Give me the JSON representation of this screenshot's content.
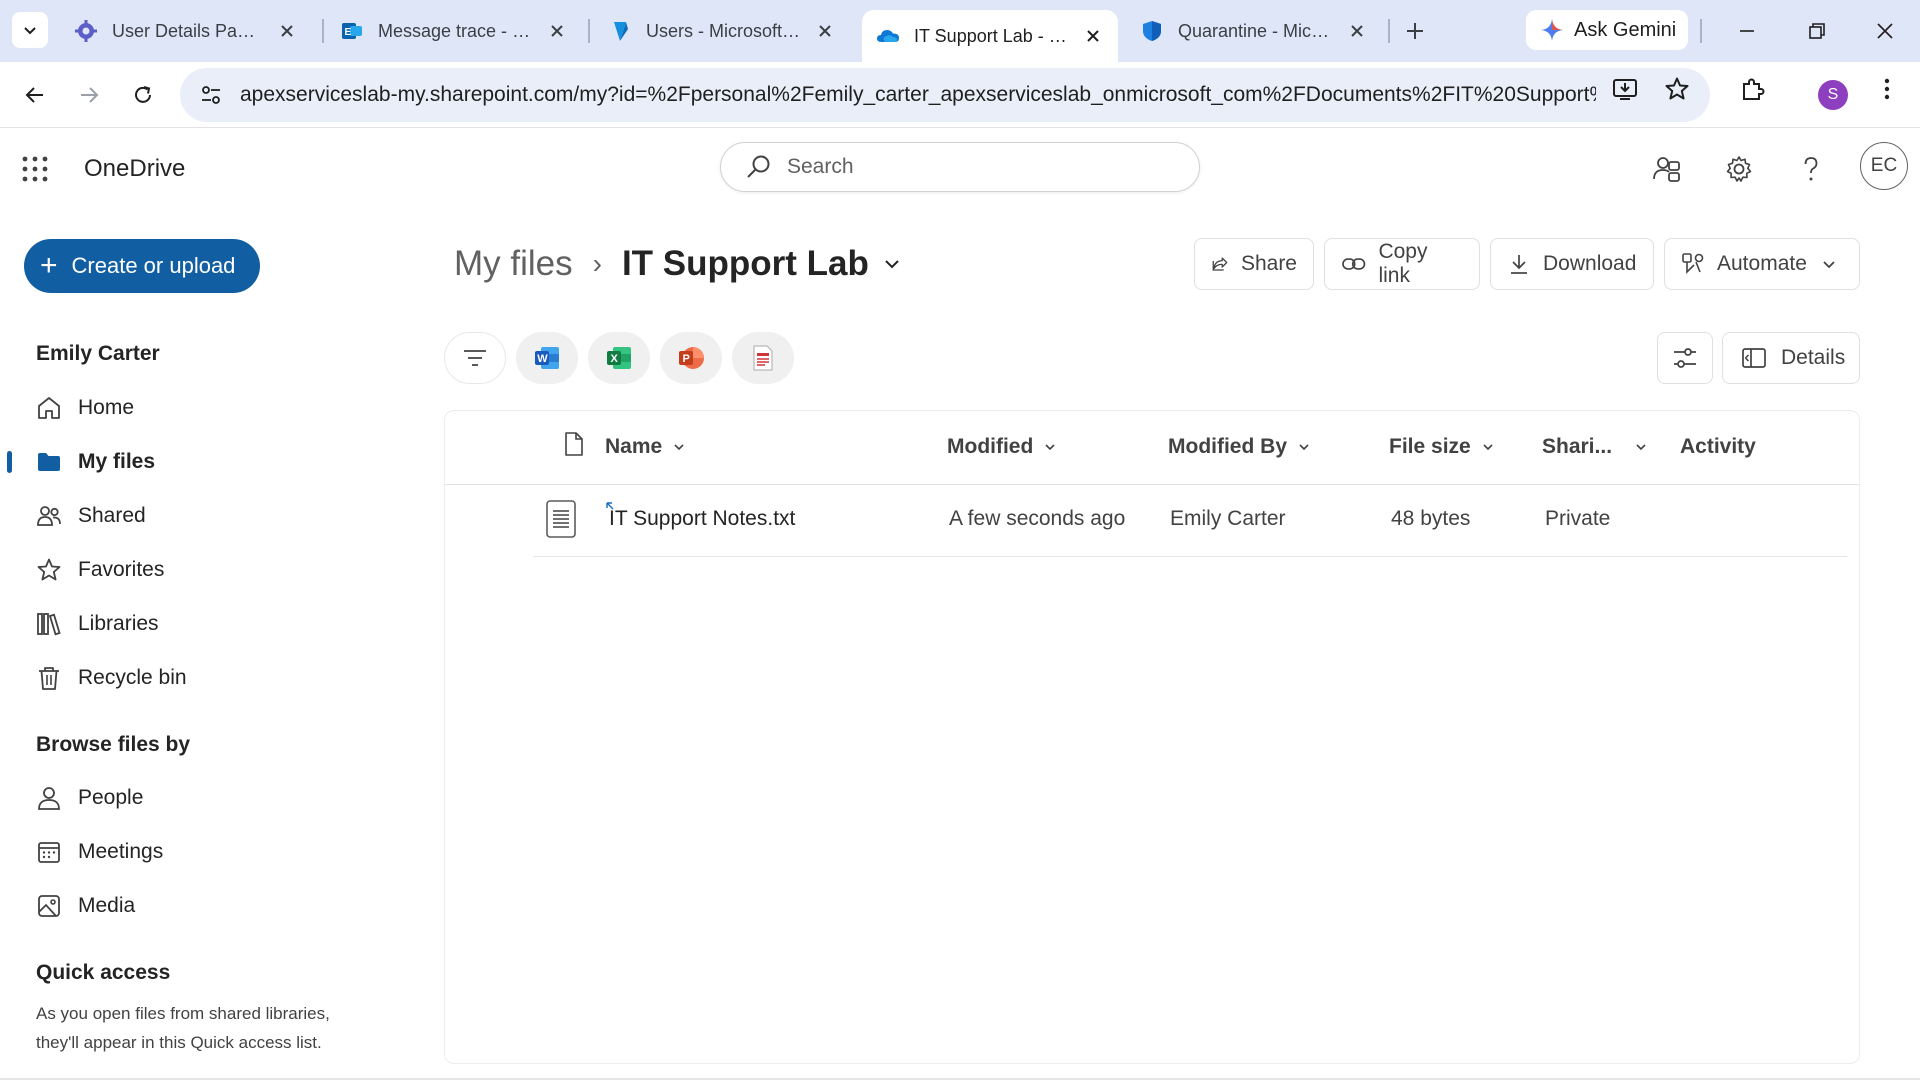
{
  "browser": {
    "tabs": [
      {
        "title": "User Details Panel -",
        "icon": "gear-icon"
      },
      {
        "title": "Message trace - Exch",
        "icon": "exchange-icon"
      },
      {
        "title": "Users - Microsoft En",
        "icon": "entra-icon"
      },
      {
        "title": "IT Support Lab - One",
        "icon": "onedrive-cloud-icon",
        "active": true
      },
      {
        "title": "Quarantine - Micros",
        "icon": "defender-shield-icon"
      }
    ],
    "gemini_label": "Ask Gemini",
    "url": "apexserviceslab-my.sharepoint.com/my?id=%2Fpersonal%2Femily_carter_apexserviceslab_onmicrosoft_com%2FDocuments%2FIT%20Support%2...",
    "profile_initial": "S",
    "profile_color": "#8e3fbf"
  },
  "app": {
    "name": "OneDrive",
    "search_placeholder": "Search",
    "user_initials": "EC",
    "accent_color": "#115ea3"
  },
  "nav": {
    "create_label": "Create or upload",
    "user_heading": "Emily Carter",
    "items": [
      {
        "label": "Home",
        "icon": "home-icon"
      },
      {
        "label": "My files",
        "icon": "folder-icon",
        "selected": true
      },
      {
        "label": "Shared",
        "icon": "people-icon"
      },
      {
        "label": "Favorites",
        "icon": "star-icon"
      },
      {
        "label": "Libraries",
        "icon": "library-icon"
      },
      {
        "label": "Recycle bin",
        "icon": "trash-icon"
      }
    ],
    "browse_heading": "Browse files by",
    "browse_items": [
      {
        "label": "People",
        "icon": "person-icon"
      },
      {
        "label": "Meetings",
        "icon": "calendar-icon"
      },
      {
        "label": "Media",
        "icon": "image-icon"
      }
    ],
    "quick_access_heading": "Quick access",
    "quick_access_text": "As you open files from shared libraries, they'll appear in this Quick access list."
  },
  "main": {
    "breadcrumb_root": "My files",
    "breadcrumb_current": "IT Support Lab",
    "commands": {
      "share": "Share",
      "copy_link": "Copy link",
      "download": "Download",
      "automate": "Automate",
      "details": "Details"
    },
    "columns": {
      "name": "Name",
      "modified": "Modified",
      "modified_by": "Modified By",
      "file_size": "File size",
      "sharing": "Shari...",
      "activity": "Activity"
    },
    "files": [
      {
        "name": "IT Support Notes.txt",
        "modified": "A few seconds ago",
        "modified_by": "Emily Carter",
        "size": "48 bytes",
        "sharing": "Private"
      }
    ]
  }
}
